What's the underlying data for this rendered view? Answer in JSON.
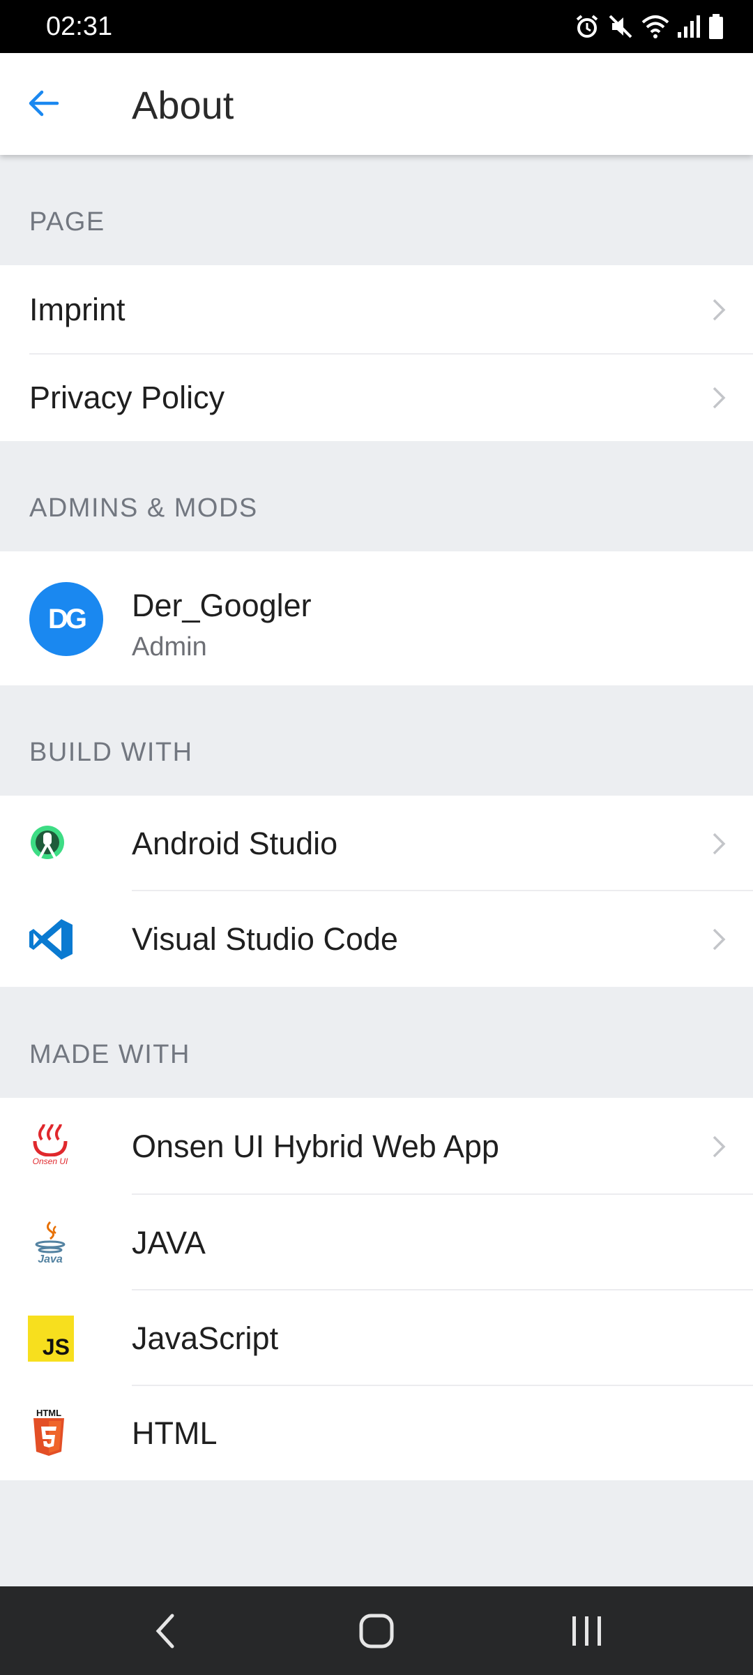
{
  "status_bar": {
    "time": "02:31",
    "icons": [
      "alarm-icon",
      "mute-icon",
      "wifi-icon",
      "signal-icon",
      "battery-icon"
    ]
  },
  "app_bar": {
    "title": "About",
    "back_icon": "arrow-left-icon"
  },
  "sections": {
    "page": {
      "header": "PAGE",
      "items": [
        {
          "label": "Imprint"
        },
        {
          "label": "Privacy Policy"
        }
      ]
    },
    "admins": {
      "header": "ADMINS & MODS",
      "items": [
        {
          "avatar_text": "DG",
          "name": "Der_Googler",
          "role": "Admin"
        }
      ]
    },
    "build_with": {
      "header": "BUILD WITH",
      "items": [
        {
          "label": "Android Studio",
          "icon": "android-studio-icon"
        },
        {
          "label": "Visual Studio Code",
          "icon": "vscode-icon"
        }
      ]
    },
    "made_with": {
      "header": "MADE WITH",
      "items": [
        {
          "label": "Onsen UI Hybrid Web App",
          "icon": "onsen-ui-icon",
          "icon_text": "Onsen UI"
        },
        {
          "label": "JAVA",
          "icon": "java-icon",
          "icon_text": "Java"
        },
        {
          "label": "JavaScript",
          "icon": "javascript-icon",
          "icon_text": "JS"
        },
        {
          "label": "HTML",
          "icon": "html5-icon",
          "icon_text": "HTML"
        }
      ]
    }
  },
  "colors": {
    "accent": "#1a88f0",
    "section_bg": "#eceef1",
    "header_text": "#727780"
  }
}
